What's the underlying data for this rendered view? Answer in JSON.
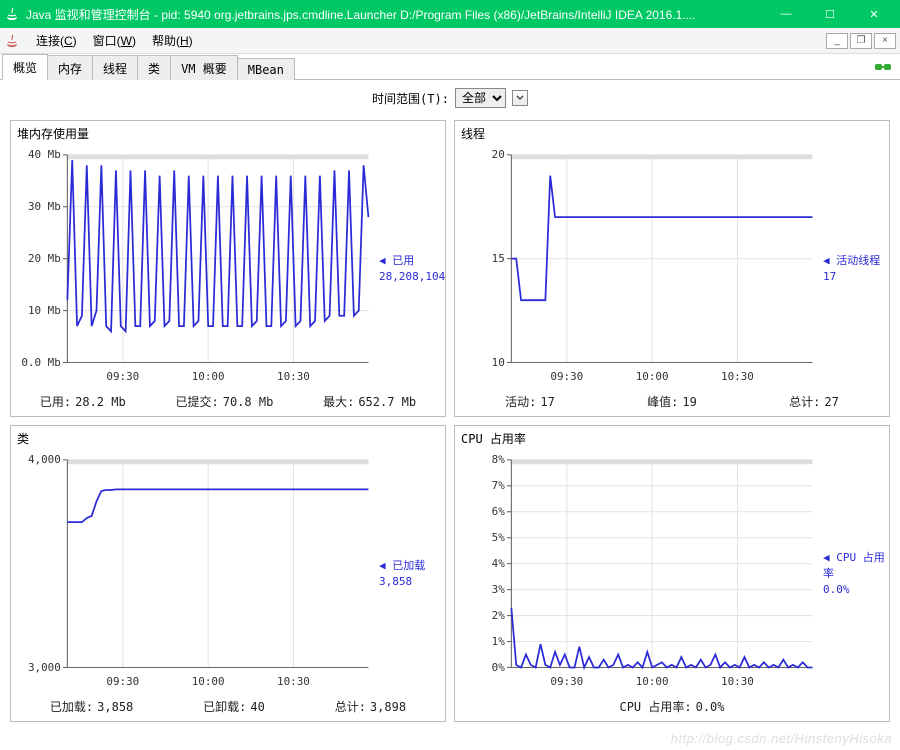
{
  "window": {
    "title": "Java 监视和管理控制台 - pid: 5940 org.jetbrains.jps.cmdline.Launcher D:/Program Files (x86)/JetBrains/IntelliJ IDEA 2016.1...."
  },
  "menu": {
    "connect": "连接(C)",
    "window": "窗口(W)",
    "help": "帮助(H)"
  },
  "tabs": [
    "概览",
    "内存",
    "线程",
    "类",
    "VM 概要",
    "MBean"
  ],
  "timeRange": {
    "label": "时间范围(T):",
    "value": "全部"
  },
  "panels": {
    "heap": {
      "title": "堆内存使用量",
      "sideLabel1": "已用",
      "sideLabel2": "28,208,104",
      "footer": [
        {
          "k": "已用:",
          "v": "28.2 Mb"
        },
        {
          "k": "已提交:",
          "v": "70.8 Mb"
        },
        {
          "k": "最大:",
          "v": "652.7 Mb"
        }
      ]
    },
    "threads": {
      "title": "线程",
      "sideLabel1": "活动线程",
      "sideLabel2": "17",
      "footer": [
        {
          "k": "活动:",
          "v": "17"
        },
        {
          "k": "峰值:",
          "v": "19"
        },
        {
          "k": "总计:",
          "v": "27"
        }
      ]
    },
    "classes": {
      "title": "类",
      "sideLabel1": "已加载",
      "sideLabel2": "3,858",
      "footer": [
        {
          "k": "已加载:",
          "v": "3,858"
        },
        {
          "k": "已卸载:",
          "v": "40"
        },
        {
          "k": "总计:",
          "v": "3,898"
        }
      ]
    },
    "cpu": {
      "title": "CPU 占用率",
      "sideLabel1": "CPU 占用率",
      "sideLabel2": "0.0%",
      "footer": [
        {
          "k": "CPU 占用率:",
          "v": "0.0%"
        }
      ]
    }
  },
  "chart_data": [
    {
      "id": "heap",
      "type": "line",
      "title": "堆内存使用量",
      "ylabel": "Mb",
      "ylim": [
        0,
        40
      ],
      "yticks": [
        {
          "v": 0,
          "l": "0.0 Mb"
        },
        {
          "v": 10,
          "l": "10 Mb"
        },
        {
          "v": 20,
          "l": "20 Mb"
        },
        {
          "v": 30,
          "l": "30 Mb"
        },
        {
          "v": 40,
          "l": "40 Mb"
        }
      ],
      "xticks": [
        "09:30",
        "10:00",
        "10:30"
      ],
      "series": [
        {
          "name": "已用",
          "values": [
            12,
            39,
            7,
            9,
            38,
            7,
            10,
            38,
            7,
            6,
            37,
            7,
            6,
            37,
            7,
            7,
            37,
            7,
            8,
            36,
            7,
            8,
            37,
            7,
            7,
            36,
            7,
            8,
            36,
            7,
            7,
            36,
            7,
            7,
            36,
            7,
            7,
            36,
            7,
            8,
            36,
            7,
            7,
            36,
            7,
            8,
            36,
            7,
            8,
            36,
            7,
            8,
            36,
            8,
            9,
            37,
            9,
            9,
            37,
            9,
            10,
            38,
            28
          ]
        }
      ]
    },
    {
      "id": "threads",
      "type": "line",
      "title": "线程",
      "ylabel": "",
      "ylim": [
        10,
        20
      ],
      "yticks": [
        {
          "v": 10,
          "l": "10"
        },
        {
          "v": 15,
          "l": "15"
        },
        {
          "v": 20,
          "l": "20"
        }
      ],
      "xticks": [
        "09:30",
        "10:00",
        "10:30"
      ],
      "series": [
        {
          "name": "活动线程",
          "values": [
            15,
            15,
            13,
            13,
            13,
            13,
            13,
            13,
            19,
            17,
            17,
            17,
            17,
            17,
            17,
            17,
            17,
            17,
            17,
            17,
            17,
            17,
            17,
            17,
            17,
            17,
            17,
            17,
            17,
            17,
            17,
            17,
            17,
            17,
            17,
            17,
            17,
            17,
            17,
            17,
            17,
            17,
            17,
            17,
            17,
            17,
            17,
            17,
            17,
            17,
            17,
            17,
            17,
            17,
            17,
            17,
            17,
            17,
            17,
            17,
            17,
            17,
            17
          ]
        }
      ]
    },
    {
      "id": "classes",
      "type": "line",
      "title": "类",
      "ylabel": "",
      "ylim": [
        3000,
        4000
      ],
      "yticks": [
        {
          "v": 3000,
          "l": "3,000"
        },
        {
          "v": 4000,
          "l": "4,000"
        }
      ],
      "xticks": [
        "09:30",
        "10:00",
        "10:30"
      ],
      "series": [
        {
          "name": "已加载",
          "values": [
            3700,
            3700,
            3700,
            3700,
            3720,
            3730,
            3800,
            3850,
            3855,
            3855,
            3858,
            3858,
            3858,
            3858,
            3858,
            3858,
            3858,
            3858,
            3858,
            3858,
            3858,
            3858,
            3858,
            3858,
            3858,
            3858,
            3858,
            3858,
            3858,
            3858,
            3858,
            3858,
            3858,
            3858,
            3858,
            3858,
            3858,
            3858,
            3858,
            3858,
            3858,
            3858,
            3858,
            3858,
            3858,
            3858,
            3858,
            3858,
            3858,
            3858,
            3858,
            3858,
            3858,
            3858,
            3858,
            3858,
            3858,
            3858,
            3858,
            3858,
            3858,
            3858,
            3858
          ]
        }
      ]
    },
    {
      "id": "cpu",
      "type": "line",
      "title": "CPU 占用率",
      "ylabel": "%",
      "ylim": [
        0,
        8
      ],
      "yticks": [
        {
          "v": 0,
          "l": "0%"
        },
        {
          "v": 1,
          "l": "1%"
        },
        {
          "v": 2,
          "l": "2%"
        },
        {
          "v": 3,
          "l": "3%"
        },
        {
          "v": 4,
          "l": "4%"
        },
        {
          "v": 5,
          "l": "5%"
        },
        {
          "v": 6,
          "l": "6%"
        },
        {
          "v": 7,
          "l": "7%"
        },
        {
          "v": 8,
          "l": "8%"
        }
      ],
      "xticks": [
        "09:30",
        "10:00",
        "10:30"
      ],
      "series": [
        {
          "name": "CPU 占用率",
          "values": [
            2.3,
            0.1,
            0.0,
            0.5,
            0.1,
            0.0,
            0.9,
            0.1,
            0.0,
            0.6,
            0.1,
            0.5,
            0.0,
            0.0,
            0.8,
            0.0,
            0.4,
            0.0,
            0.0,
            0.3,
            0.0,
            0.1,
            0.5,
            0.0,
            0.1,
            0.0,
            0.2,
            0.0,
            0.6,
            0.0,
            0.1,
            0.2,
            0.0,
            0.1,
            0.0,
            0.4,
            0.0,
            0.1,
            0.0,
            0.3,
            0.0,
            0.1,
            0.5,
            0.0,
            0.2,
            0.0,
            0.1,
            0.0,
            0.4,
            0.0,
            0.1,
            0.0,
            0.2,
            0.0,
            0.1,
            0.0,
            0.3,
            0.0,
            0.1,
            0.0,
            0.2,
            0.0,
            0.0
          ]
        }
      ]
    }
  ],
  "watermark": "http://blog.csdn.net/HinstenyHisoka"
}
